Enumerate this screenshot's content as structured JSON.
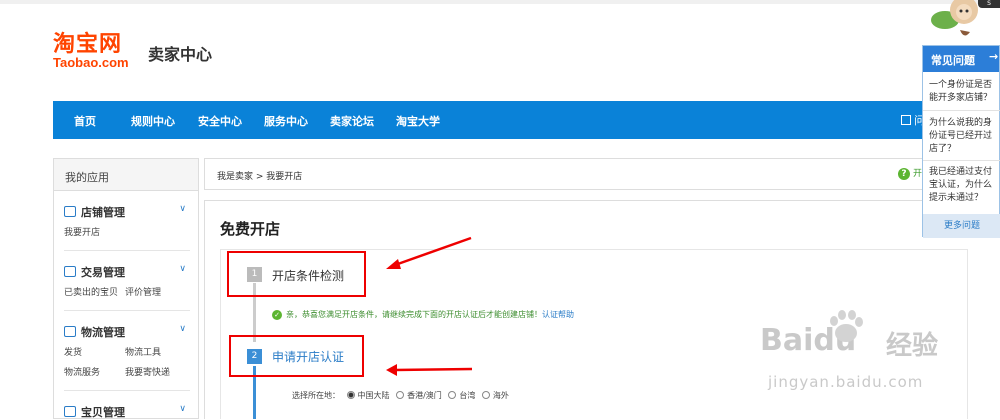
{
  "header": {
    "logo_cn": "淘宝网",
    "logo_en": "Taobao.com",
    "title": "卖家中心"
  },
  "nav": {
    "items": [
      "首页",
      "规则中心",
      "安全中心",
      "服务中心",
      "卖家论坛",
      "淘宝大学"
    ],
    "right_fragment": "问"
  },
  "sidebar": {
    "heading": "我的应用",
    "groups": [
      {
        "title": "店铺管理",
        "links": [
          "我要开店"
        ],
        "icon": "store-icon"
      },
      {
        "title": "交易管理",
        "links": [
          "已卖出的宝贝",
          "评价管理"
        ],
        "icon": "trade-icon"
      },
      {
        "title": "物流管理",
        "links": [
          "发货",
          "物流工具",
          "物流服务",
          "我要寄快递"
        ],
        "icon": "truck-icon"
      },
      {
        "title": "宝贝管理",
        "links": [],
        "icon": "shirt-icon"
      }
    ]
  },
  "breadcrumb": "我是卖家 > 我要开店",
  "help_link": "开",
  "main": {
    "title": "免费开店",
    "step1": {
      "num": "1",
      "label": "开店条件检测"
    },
    "check_message": "亲，恭喜您满足开店条件，请继续完成下面的开店认证后才能创建店铺！",
    "check_help": "认证帮助",
    "step2": {
      "num": "2",
      "label": "申请开店认证"
    },
    "region_label": "选择所在地：",
    "regions": [
      "中国大陆",
      "香港/澳门",
      "台湾",
      "海外"
    ],
    "region_selected": "中国大陆"
  },
  "faq": {
    "title": "常见问题",
    "items": [
      [
        "一个身份证是否",
        "能开多家店铺？"
      ],
      [
        "为什么说我的身",
        "份证号已经开过",
        "店了？"
      ],
      [
        "我已经通过支付",
        "宝认证，为什么",
        "提示未通过？"
      ]
    ],
    "more": "更多问题"
  },
  "watermark": {
    "brand": "Baidu",
    "cn": "经验",
    "url": "jingyan.baidu.com"
  },
  "mascot_badge": "S"
}
